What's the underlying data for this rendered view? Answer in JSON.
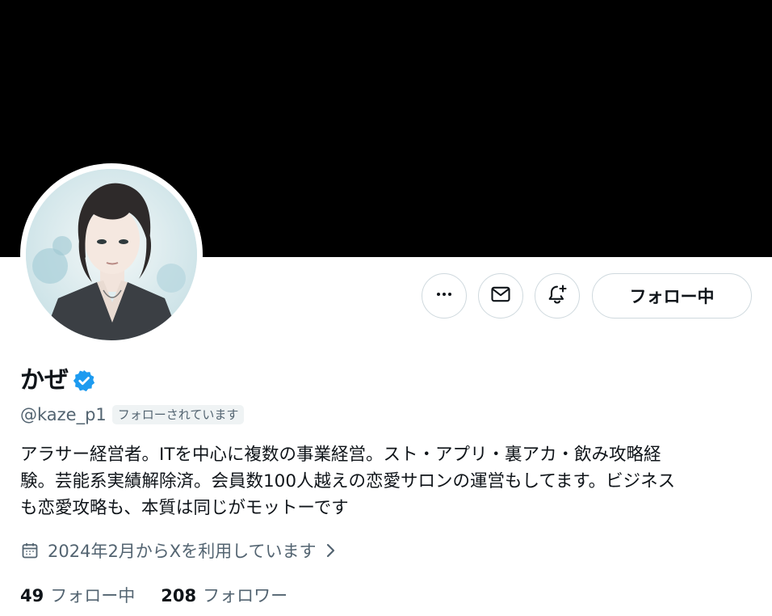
{
  "profile": {
    "display_name": "かぜ",
    "handle": "@kaze_p1",
    "follows_you_badge": "フォローされています",
    "bio": "アラサー経営者。ITを中心に複数の事業経営。スト・アプリ・裏アカ・飲み攻略経\n験。芸能系実績解除済。会員数100人越えの恋愛サロンの運営もしてます。ビジネス\nも恋愛攻略も、本質は同じがモットーです",
    "joined": "2024年2月からXを利用しています",
    "following_count": "49",
    "following_label": "フォロー中",
    "followers_count": "208",
    "followers_label": "フォロワー"
  },
  "actions": {
    "more_icon": "more-icon",
    "message_icon": "mail-icon",
    "notify_icon": "bell-plus-icon",
    "follow_state_label": "フォロー中"
  },
  "colors": {
    "banner": "#000000",
    "verified": "#1d9bf0",
    "secondary_text": "#536471",
    "border": "#cfd9de"
  }
}
